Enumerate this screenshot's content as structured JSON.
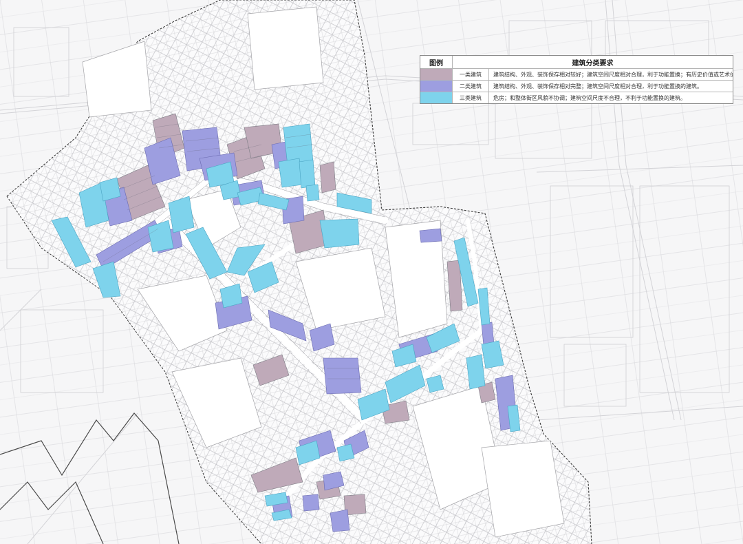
{
  "legend": {
    "header_col1": "图例",
    "header_col2": "建筑分类要求",
    "items": [
      {
        "label": "一类建筑",
        "description": "建筑结构、外观、装饰保存相对较好；建筑空间尺度相对合理，利于功能置换；有历史价值或艺术价值的建筑。",
        "color": "#bfaab9"
      },
      {
        "label": "二类建筑",
        "description": "建筑结构、外观、装饰保存相对完整；建筑空间尺度相对合理，利于功能置换的建筑。",
        "color": "#9d9ee0"
      },
      {
        "label": "三类建筑",
        "description": "危房；和整体街区风貌不协调；建筑空间尺度不合理，不利于功能置换的建筑。",
        "color": "#7ed3ec"
      }
    ]
  },
  "map_colors": {
    "background": "#f6f6f7",
    "block_outline": "#a4a4a8",
    "road": "#ffffff",
    "context_lines": "#c8c8cc",
    "dark_boundary": "#4a4a4a"
  }
}
